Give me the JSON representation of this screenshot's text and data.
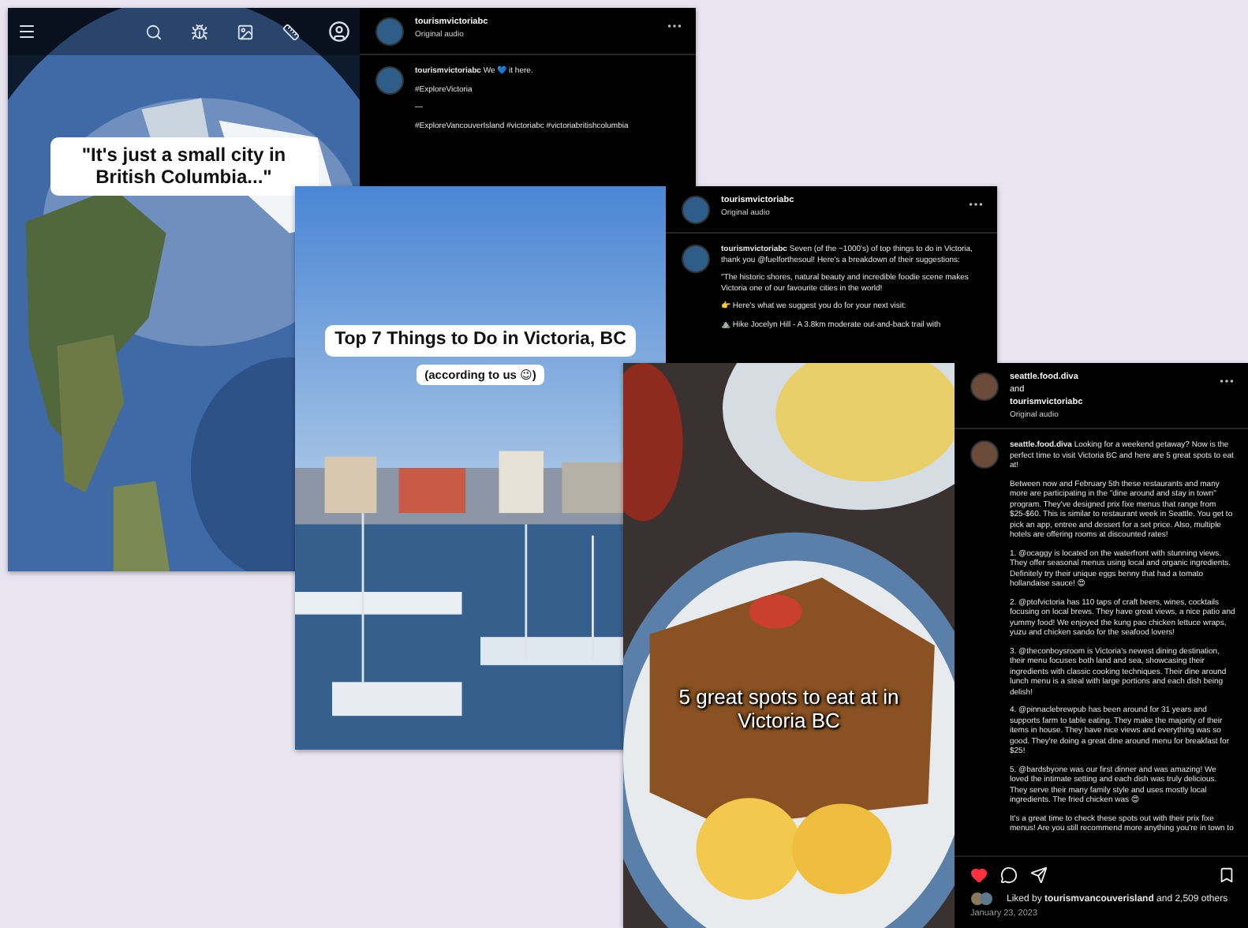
{
  "posts": [
    {
      "kind": "globe",
      "captions": [
        {
          "text": "\"It's just a small city in British Columbia...\""
        }
      ],
      "header": {
        "names": [
          "tourismvictoriabc"
        ],
        "audio": "Original audio"
      },
      "paragraphs": [
        "**tourismvictoriabc** We 💙 it here.",
        "#ExploreVictoria",
        "—",
        "#ExploreVancouverIsland #victoriabc #victoriabritishcolumbia"
      ]
    },
    {
      "kind": "marina",
      "captions": [
        {
          "text": "Top 7 Things to Do in Victoria, BC"
        },
        {
          "text": "(according to us 😉)"
        }
      ],
      "header": {
        "names": [
          "tourismvictoriabc"
        ],
        "audio": "Original audio"
      },
      "paragraphs": [
        "**tourismvictoriabc** Seven (of the ~1000's) of top things to do in Victoria, thank you @fuelforthesoul! Here's a breakdown of their suggestions:",
        "\"The historic shores, natural beauty and incredible foodie scene makes Victoria one of our favourite cities in the world!",
        "👉 Here's what we suggest you do for your next visit:",
        "⛰️ Hike Jocelyn Hill - A 3.8km moderate out-and-back trail with"
      ]
    },
    {
      "kind": "food",
      "captions": [
        {
          "text": "5 great spots to eat at in Victoria BC"
        }
      ],
      "header": {
        "names": [
          "seattle.food.diva",
          "and",
          "tourismvictoriabc"
        ],
        "audio": "Original audio"
      },
      "paragraphs": [
        "**seattle.food.diva** Looking for a weekend getaway? Now is the perfect time to visit Victoria BC and here are 5 great spots to eat at!",
        "Between now and February 5th these restaurants and many more are participating in the \"dine around and stay in town\" program. They've designed prix fixe menus that range from $25-$60. This is similar to restaurant week in Seattle. You get to pick an app, entree and dessert for a set price. Also, multiple hotels are offering rooms at discounted rates!",
        "1. @ocaggy is located on the waterfront with stunning views. They offer seasonal menus using local and organic ingredients. Definitely try their unique eggs benny that had a tomato hollandaise sauce! 😍",
        "2. @ptofvictoria has 110 taps of craft beers, wines, cocktails focusing on local brews. They have great views, a nice patio and yummy food! We enjoyed the kung pao chicken lettuce wraps, yuzu and chicken sando for the seafood lovers!",
        "3. @theconboysroom is Victoria's newest dining destination, their menu focuses both land and sea, showcasing their ingredients with classic cooking techniques. Their dine around lunch menu is a steal with large portions and each dish being delish!",
        "4. @pinnaclebrewpub has been around for 31 years and supports farm to table eating. They make the majority of their items in house. They have nice views and everything was so good. They're doing a great dine around menu for breakfast for $25!",
        "5. @bardsbyone was our first dinner and was amazing! We loved the intimate setting and each dish was truly delicious. They serve their many family style and uses mostly local ingredients. The fried chicken was 😍",
        "It's a great time to check these spots out with their prix fixe menus! Are you still recommend more anything you're in town to"
      ],
      "likes": "Liked by **tourismvancouverisland** and 2,509 others",
      "date": "January 23, 2023",
      "liked": true
    }
  ]
}
